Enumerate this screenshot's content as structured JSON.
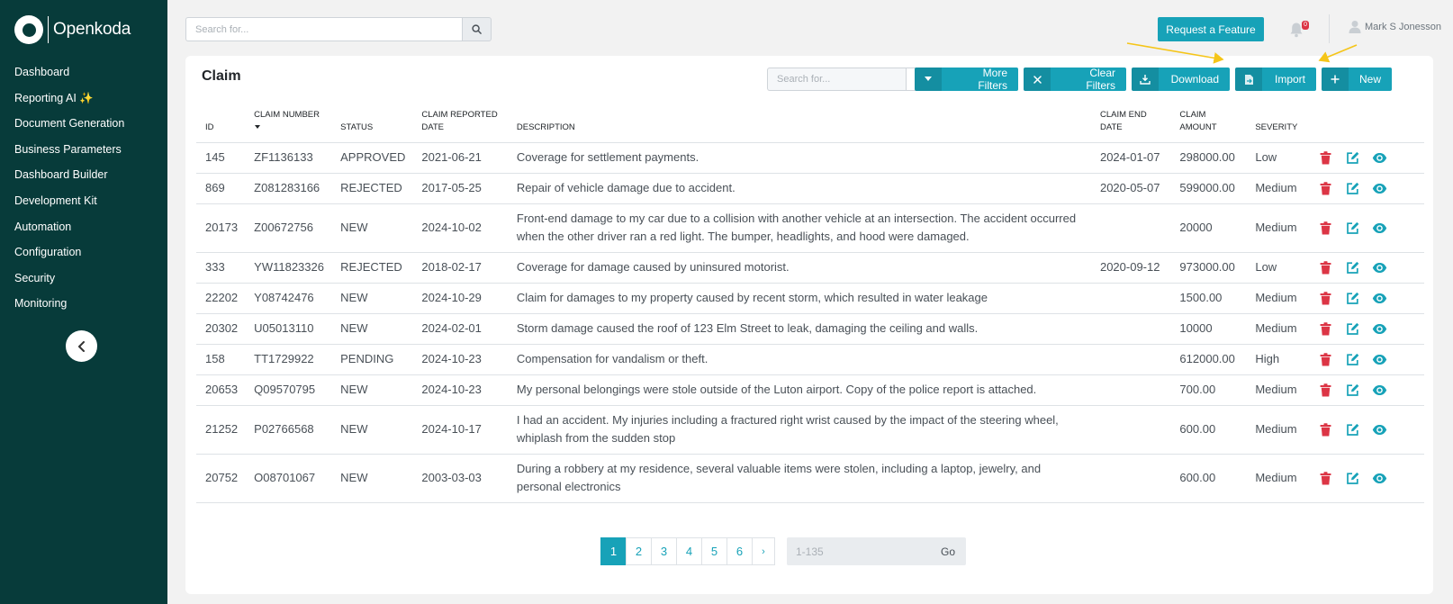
{
  "brand": {
    "name": "Openkoda"
  },
  "sidebar": {
    "items": [
      {
        "label": "Dashboard"
      },
      {
        "label": "Reporting AI ✨"
      },
      {
        "label": "Document Generation"
      },
      {
        "label": "Business Parameters"
      },
      {
        "label": "Dashboard Builder"
      },
      {
        "label": "Development Kit"
      },
      {
        "label": "Automation"
      },
      {
        "label": "Configuration"
      },
      {
        "label": "Security"
      },
      {
        "label": "Monitoring"
      }
    ]
  },
  "topbar": {
    "search_placeholder": "Search for...",
    "request_feature": "Request a Feature",
    "notifications_count": "0",
    "user_name": "Mark S Jonesson"
  },
  "card": {
    "title": "Claim",
    "search_placeholder": "Search for...",
    "buttons": {
      "more_filters": "More Filters",
      "clear_filters": "Clear Filters",
      "download": "Download",
      "import": "Import",
      "new": "New"
    }
  },
  "table": {
    "headers": {
      "id": "ID",
      "claim_number": "CLAIM NUMBER",
      "status": "STATUS",
      "claim_reported_date": "CLAIM REPORTED DATE",
      "description": "DESCRIPTION",
      "claim_end_date": "CLAIM END DATE",
      "claim_amount": "CLAIM AMOUNT",
      "severity": "SEVERITY"
    },
    "rows": [
      {
        "id": "145",
        "number": "ZF1136133",
        "status": "APPROVED",
        "reported": "2021-06-21",
        "description": "Coverage for settlement payments.",
        "end_date": "2024-01-07",
        "amount": "298000.00",
        "severity": "Low"
      },
      {
        "id": "869",
        "number": "Z081283166",
        "status": "REJECTED",
        "reported": "2017-05-25",
        "description": "Repair of vehicle damage due to accident.",
        "end_date": "2020-05-07",
        "amount": "599000.00",
        "severity": "Medium"
      },
      {
        "id": "20173",
        "number": "Z00672756",
        "status": "NEW",
        "reported": "2024-10-02",
        "description": "Front-end damage to my car due to a collision with another vehicle at an intersection. The accident occurred when the other driver ran a red light. The bumper, headlights, and hood were damaged.",
        "end_date": "",
        "amount": "20000",
        "severity": "Medium"
      },
      {
        "id": "333",
        "number": "YW11823326",
        "status": "REJECTED",
        "reported": "2018-02-17",
        "description": "Coverage for damage caused by uninsured motorist.",
        "end_date": "2020-09-12",
        "amount": "973000.00",
        "severity": "Low"
      },
      {
        "id": "22202",
        "number": "Y08742476",
        "status": "NEW",
        "reported": "2024-10-29",
        "description": "Claim for damages to my property caused by recent storm, which resulted in water leakage",
        "end_date": "",
        "amount": "1500.00",
        "severity": "Medium"
      },
      {
        "id": "20302",
        "number": "U05013110",
        "status": "NEW",
        "reported": "2024-02-01",
        "description": "Storm damage caused the roof of 123 Elm Street to leak, damaging the ceiling and walls.",
        "end_date": "",
        "amount": "10000",
        "severity": "Medium"
      },
      {
        "id": "158",
        "number": "TT1729922",
        "status": "PENDING",
        "reported": "2024-10-23",
        "description": "Compensation for vandalism or theft.",
        "end_date": "",
        "amount": "612000.00",
        "severity": "High"
      },
      {
        "id": "20653",
        "number": "Q09570795",
        "status": "NEW",
        "reported": "2024-10-23",
        "description": "My personal belongings were stole outside of the Luton airport. Copy of the police report is attached.",
        "end_date": "",
        "amount": "700.00",
        "severity": "Medium"
      },
      {
        "id": "21252",
        "number": "P02766568",
        "status": "NEW",
        "reported": "2024-10-17",
        "description": "I had an accident. My injuries including a fractured right wrist caused by the impact of the steering wheel, whiplash from the sudden stop",
        "end_date": "",
        "amount": "600.00",
        "severity": "Medium"
      },
      {
        "id": "20752",
        "number": "O08701067",
        "status": "NEW",
        "reported": "2003-03-03",
        "description": "During a robbery at my residence, several valuable items were stolen, including a laptop, jewelry, and personal electronics",
        "end_date": "",
        "amount": "600.00",
        "severity": "Medium"
      }
    ]
  },
  "pagination": {
    "pages": [
      "1",
      "2",
      "3",
      "4",
      "5",
      "6"
    ],
    "active_page": "1",
    "next": "›",
    "goto_placeholder": "1-135",
    "go_label": "Go"
  },
  "colors": {
    "sidebar_bg": "#073b3a",
    "accent": "#17a2b8",
    "delete": "#dc3545",
    "annotation_arrow": "#f5c518"
  }
}
